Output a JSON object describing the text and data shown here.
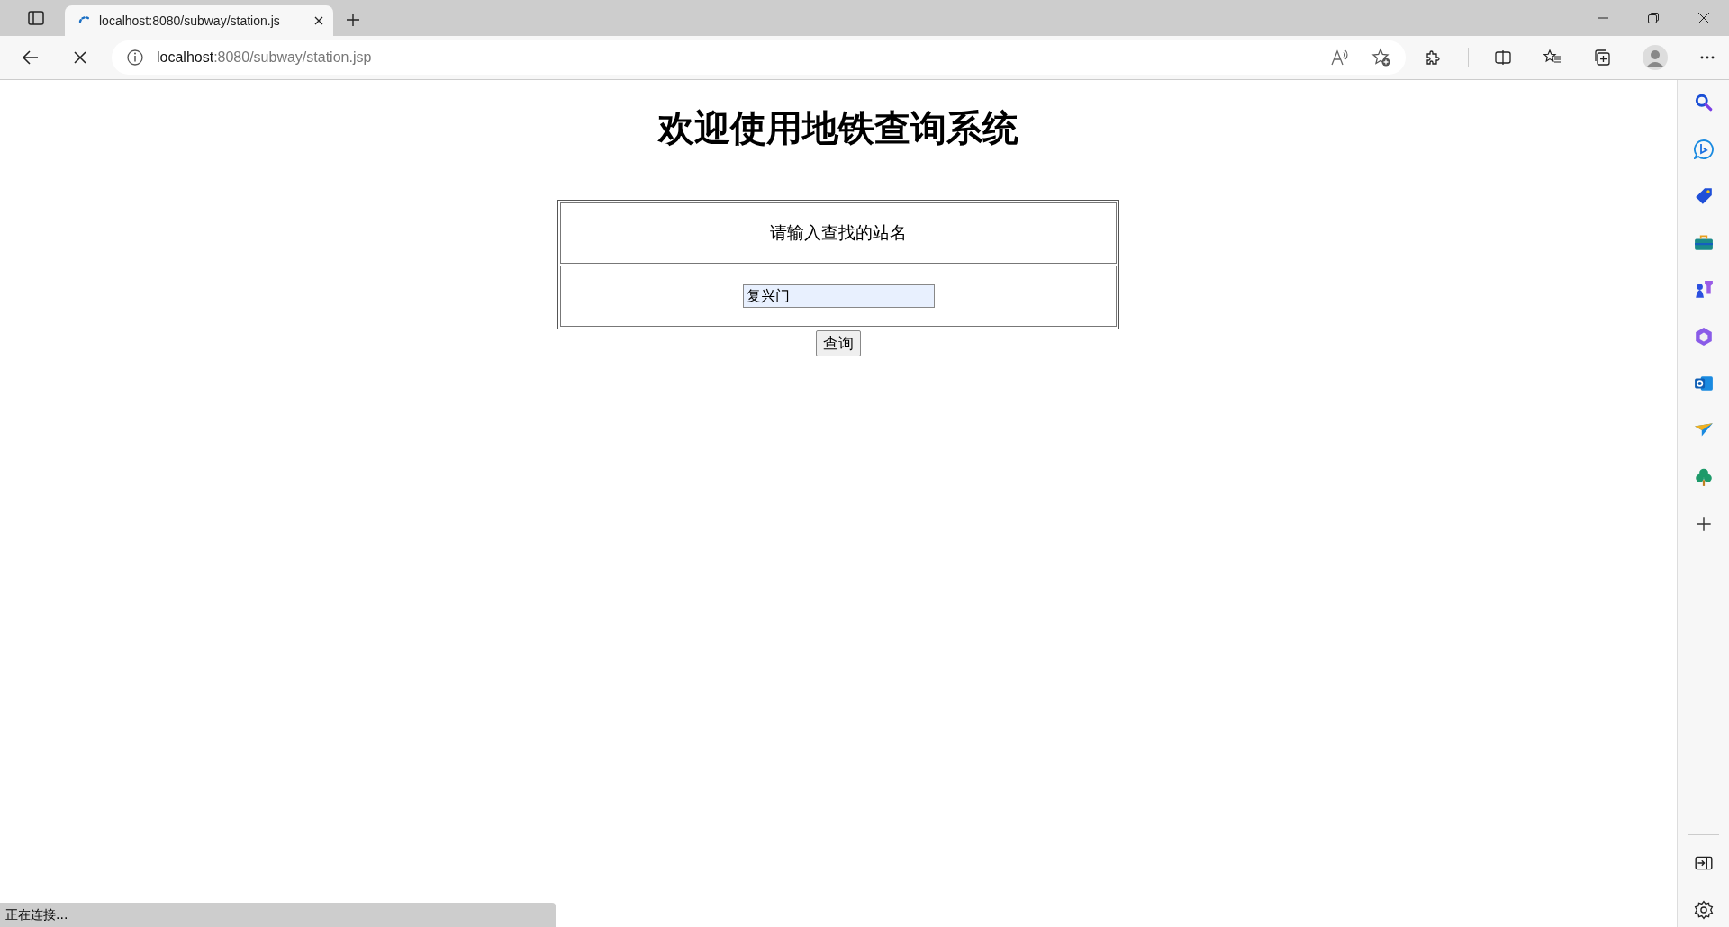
{
  "browser": {
    "tab": {
      "title": "localhost:8080/subway/station.js",
      "loading": true
    },
    "address": {
      "host": "localhost",
      "path": ":8080/subway/station.jsp"
    }
  },
  "page": {
    "heading": "欢迎使用地铁查询系统",
    "prompt": "请输入查找的站名",
    "station_field": {
      "value": "复兴门"
    },
    "query_button": "查询"
  },
  "status_bar": "正在连接..."
}
